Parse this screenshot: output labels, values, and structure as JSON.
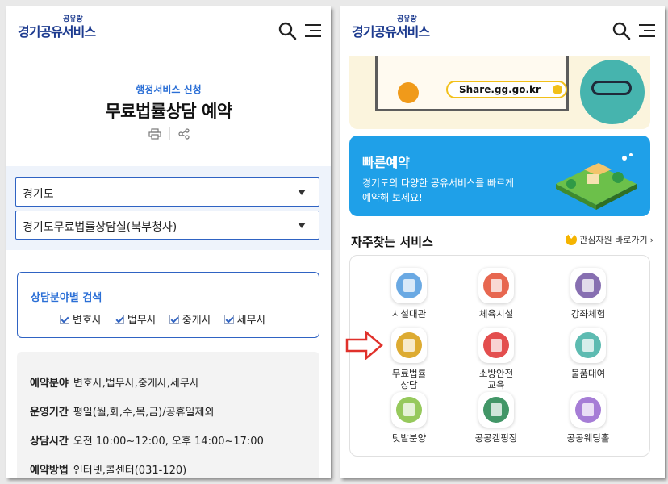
{
  "left": {
    "logo": {
      "main": "경기공유서비스",
      "sub": "공유랑"
    },
    "header_icons": [
      "search-icon",
      "menu-icon"
    ],
    "subtitle": "행정서비스 신청",
    "title": "무료법률상담 예약",
    "tools": [
      "print-icon",
      "share-icon"
    ],
    "select_region": "경기도",
    "select_place": "경기도무료법률상담실(북부청사)",
    "field_search": {
      "title": "상담분야별 검색",
      "options": [
        "변호사",
        "법무사",
        "중개사",
        "세무사"
      ]
    },
    "info": [
      {
        "label": "예약분야",
        "value": "변호사,법무사,중개사,세무사"
      },
      {
        "label": "운영기간",
        "value": "평일(월,화,수,목,금)/공휴일제외"
      },
      {
        "label": "상담시간",
        "value": "오전 10:00~12:00, 오후 14:00~17:00"
      },
      {
        "label": "예약방법",
        "value": "인터넷,콜센터(031-120)"
      }
    ]
  },
  "right": {
    "logo": {
      "main": "경기공유서비스",
      "sub": "공유랑"
    },
    "banner_url": "Share.gg.go.kr",
    "quick": {
      "title": "빠른예약",
      "desc": "경기도의 다양한 공유서비스를 빠르게 예약해 보세요!"
    },
    "section_title": "자주찾는 서비스",
    "fav_link": "관심자원 바로가기",
    "services": [
      {
        "label": "시설대관",
        "icon": "building-icon",
        "color": "#5aa0e0"
      },
      {
        "label": "체육시설",
        "icon": "sports-icon",
        "color": "#e4573d"
      },
      {
        "label": "강좌체험",
        "icon": "lecture-icon",
        "color": "#7a5fa8"
      },
      {
        "label": "무료법률\n상담",
        "icon": "gavel-icon",
        "color": "#d9a21c"
      },
      {
        "label": "소방안전\n교육",
        "icon": "fire-extinguisher-icon",
        "color": "#e03b3b"
      },
      {
        "label": "물품대여",
        "icon": "box-icon",
        "color": "#4bb4a8"
      },
      {
        "label": "텃밭분양",
        "icon": "plant-icon",
        "color": "#8bc34a"
      },
      {
        "label": "공공캠핑장",
        "icon": "tent-icon",
        "color": "#2e8b57"
      },
      {
        "label": "공공웨딩홀",
        "icon": "wedding-icon",
        "color": "#9c6fd1"
      }
    ],
    "pointer_color": "#e0312b"
  }
}
